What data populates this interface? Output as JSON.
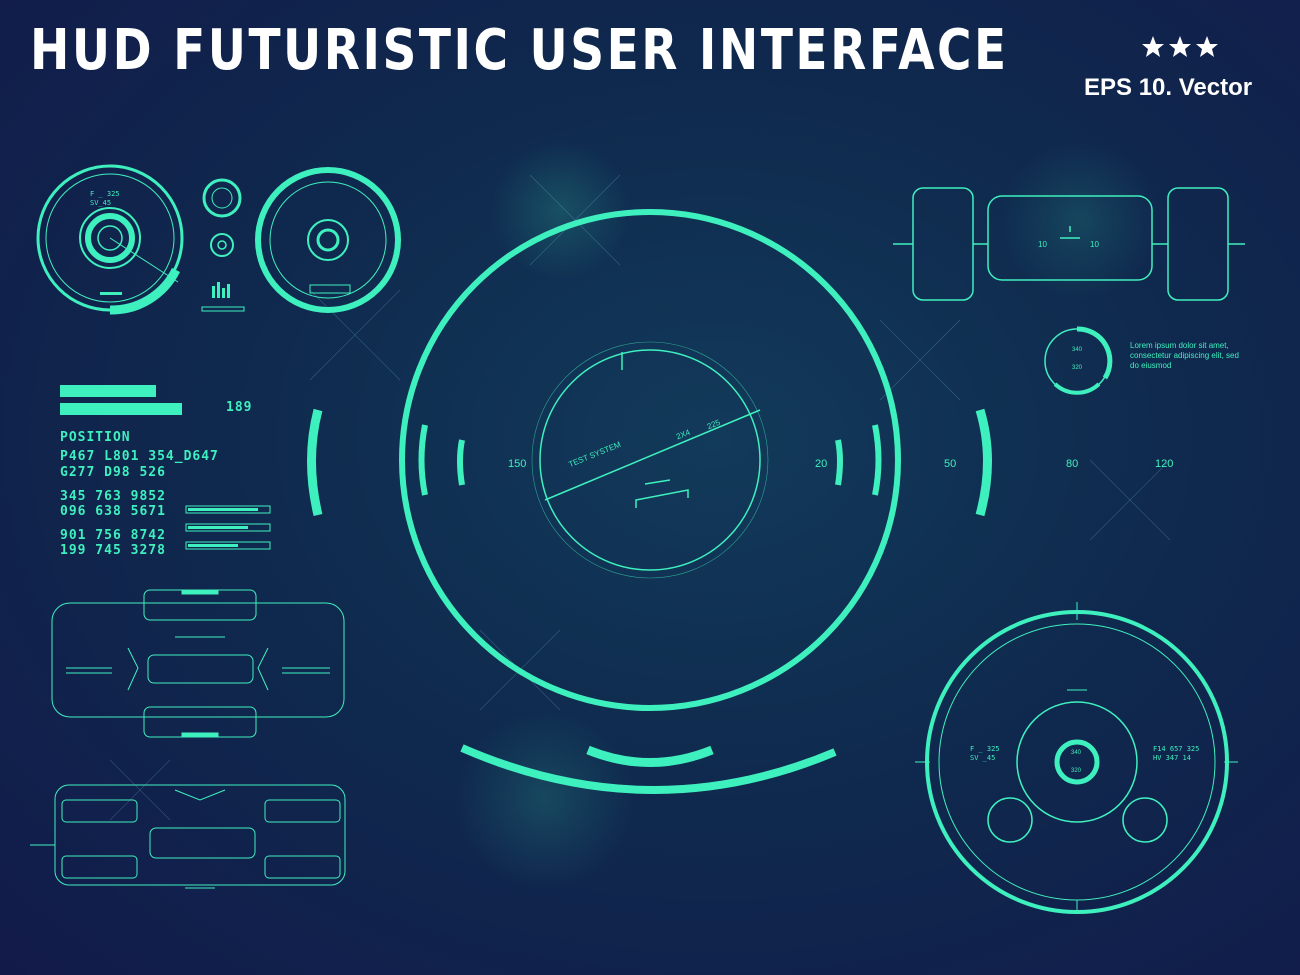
{
  "header": {
    "title": "HUD FUTURISTIC USER INTERFACE",
    "subtitle": "EPS 10. Vector",
    "star_count": 3
  },
  "colors": {
    "accent": "#3ff0bf",
    "background": "#0f2a4e",
    "title": "#ffffff"
  },
  "left_panel": {
    "number": "189",
    "position_label": "POSITION",
    "code_lines": [
      "P467 L801 354_D647",
      "G277 D98 526"
    ],
    "number_lines": [
      "345 763 9852",
      "096 638 5671",
      "901 756 8742",
      "199 745 3278"
    ]
  },
  "gauges": {
    "gauge1_top": "F _ 325",
    "gauge1_sub": "SV_45",
    "bottom_left": "F _ 325",
    "bottom_left_sub": "SV _45",
    "bottom_right": "F14 657 325",
    "bottom_right_sub": "HV 347 14",
    "inner_top": "340",
    "inner_bottom": "320"
  },
  "small_gauge": {
    "top": "340",
    "bottom": "320"
  },
  "lorem": "Lorem ipsum dolor sit amet, consectetur adipiscing elit, sed do eiusmod",
  "center": {
    "system_label": "TEST SYSTEM",
    "code_a": "2X4",
    "code_b": "225",
    "left_value": "150",
    "right_value": "20"
  },
  "scale_values": [
    "50",
    "80",
    "120"
  ],
  "top_right": {
    "left_value": "10",
    "right_value": "10"
  }
}
